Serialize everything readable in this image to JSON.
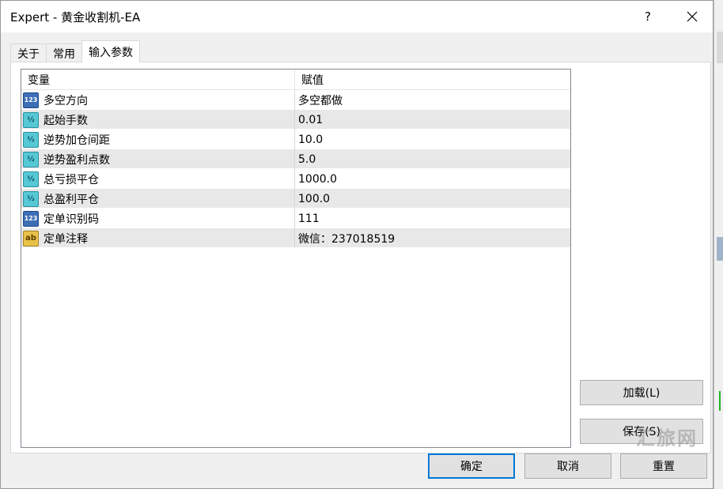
{
  "window": {
    "title": "Expert - 黄金收割机-EA",
    "help_label": "?"
  },
  "tabs": [
    {
      "label": "关于",
      "active": false
    },
    {
      "label": "常用",
      "active": false
    },
    {
      "label": "输入参数",
      "active": true
    }
  ],
  "grid": {
    "headers": {
      "name": "变量",
      "value": "赋值"
    },
    "rows": [
      {
        "icon": "int-icon",
        "badge": "123",
        "name": "多空方向",
        "value": "多空都做"
      },
      {
        "icon": "double-icon",
        "badge": "½",
        "name": "起始手数",
        "value": "0.01"
      },
      {
        "icon": "double-icon",
        "badge": "½",
        "name": "逆势加仓间距",
        "value": "10.0"
      },
      {
        "icon": "double-icon",
        "badge": "½",
        "name": "逆势盈利点数",
        "value": "5.0"
      },
      {
        "icon": "double-icon",
        "badge": "½",
        "name": "总亏损平仓",
        "value": "1000.0"
      },
      {
        "icon": "double-icon",
        "badge": "½",
        "name": "总盈利平仓",
        "value": "100.0"
      },
      {
        "icon": "int-icon",
        "badge": "123",
        "name": "定单识别码",
        "value": "111"
      },
      {
        "icon": "string-icon",
        "badge": "ab",
        "name": "定单注释",
        "value": "微信：237018519"
      }
    ]
  },
  "side_buttons": {
    "load": "加载(L)",
    "save": "保存(S)"
  },
  "bottom_buttons": {
    "ok": "确定",
    "cancel": "取消",
    "reset": "重置"
  },
  "watermark": "汇旅网",
  "colors": {
    "accent": "#0078d7",
    "row_alt": "#e8e8e8",
    "dialog_bg": "#f0f0f0"
  }
}
